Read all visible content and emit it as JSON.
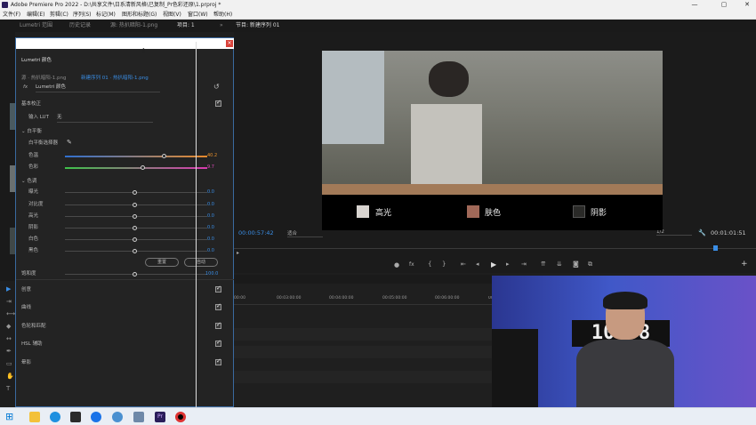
{
  "window": {
    "title": "Adobe Premiere Pro 2022 - D:\\共享文件\\日系清新风格\\已复制_Pr色彩还原\\1.prproj *",
    "minimize": "—",
    "maximize": "▢",
    "close": "✕"
  },
  "menu": [
    "文件(F)",
    "编辑(E)",
    "剪辑(C)",
    "序列(S)",
    "标记(M)",
    "图形和标题(G)",
    "视图(V)",
    "窗口(W)",
    "帮助(H)"
  ],
  "tabs": {
    "lumetri_scopes": "Lumetri 范围",
    "history": "历史记录",
    "source": "源: 热扒暗阳-1.png",
    "project": "项目: 1",
    "overflow": "»",
    "program": "节目: 新建序列 01"
  },
  "lumetri": {
    "panel_title": "Lumetri 颜色",
    "source_clip": "源 · 热扒暗阳-1.png",
    "sequence_clip": "新建序列 01 · 热扒暗阳-1.png",
    "fx_label": "fx",
    "effect_name": "Lumetri 颜色",
    "basic_correction": "基本校正",
    "input_lut_label": "输入 LUT",
    "input_lut_value": "无",
    "white_balance": "白平衡",
    "wb_picker": "白平衡选择器",
    "temperature": {
      "label": "色温",
      "value": "40.2"
    },
    "tint": {
      "label": "色彩",
      "value": "9.7"
    },
    "tone": "色调",
    "exposure": {
      "label": "曝光",
      "value": "0.0"
    },
    "contrast": {
      "label": "对比度",
      "value": "0.0"
    },
    "highlights": {
      "label": "高光",
      "value": "0.0"
    },
    "shadows": {
      "label": "阴影",
      "value": "0.0"
    },
    "whites": {
      "label": "白色",
      "value": "0.0"
    },
    "blacks": {
      "label": "黑色",
      "value": "0.0"
    },
    "reset_btn": "重置",
    "auto_btn": "自动",
    "saturation": {
      "label": "饱和度",
      "value": "100.0"
    },
    "sections": [
      "创意",
      "曲线",
      "色轮和匹配",
      "HSL 辅助",
      "晕影"
    ]
  },
  "program": {
    "timecode": "00:00:57:42",
    "fit": "适合",
    "resolution": "1/2",
    "duration": "00:01:01:51",
    "swatches": [
      {
        "label": "高光",
        "color": "#d8d4d0"
      },
      {
        "label": "肤色",
        "color": "#a06858"
      },
      {
        "label": "阴影",
        "color": "#2a2a28"
      }
    ]
  },
  "timeline": {
    "ruler": [
      "00:00",
      "00:03:00:00",
      "00:04:00:00",
      "00:05:00:00",
      "00:06:00:00",
      "00:07:00:00"
    ]
  },
  "webcam": {
    "clock": "10 58"
  }
}
